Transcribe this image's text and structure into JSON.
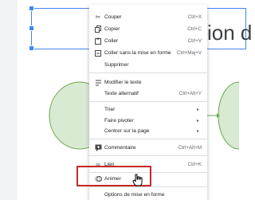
{
  "slide": {
    "title_fragment": "ion d"
  },
  "context_menu": {
    "items": [
      {
        "icon": "scissors-icon",
        "label": "Couper",
        "shortcut": "Ctrl+X"
      },
      {
        "icon": "copy-icon",
        "label": "Copier",
        "shortcut": "Ctrl+C"
      },
      {
        "icon": "paste-icon",
        "label": "Coller",
        "shortcut": "Ctrl+V"
      },
      {
        "icon": "paste-plain-icon",
        "label": "Coller sans la mise en forme",
        "shortcut": "Ctrl+Maj+V"
      },
      {
        "label": "Supprimer"
      },
      {
        "icon": "edit-text-icon",
        "label": "Modifier le texte"
      },
      {
        "label": "Texte alternatif",
        "shortcut": "Ctrl+Alt+Y"
      },
      {
        "label": "Trier",
        "arrow": "▸"
      },
      {
        "label": "Faire pivoter",
        "arrow": "▸"
      },
      {
        "label": "Centrer sur la page",
        "arrow": "▸"
      },
      {
        "icon": "comment-icon",
        "label": "Commentaire",
        "shortcut": "Ctrl+Alt+M"
      },
      {
        "icon": "link-icon",
        "label": "Lien",
        "shortcut": "Ctrl+K"
      },
      {
        "icon": "animate-icon",
        "label": "Animer"
      },
      {
        "label": "Options de mise en forme"
      }
    ]
  },
  "colors": {
    "selection": "#4285f4",
    "highlight_box": "#c62828",
    "shape_fill": "#d9ead3",
    "shape_stroke": "#6aa84f"
  }
}
